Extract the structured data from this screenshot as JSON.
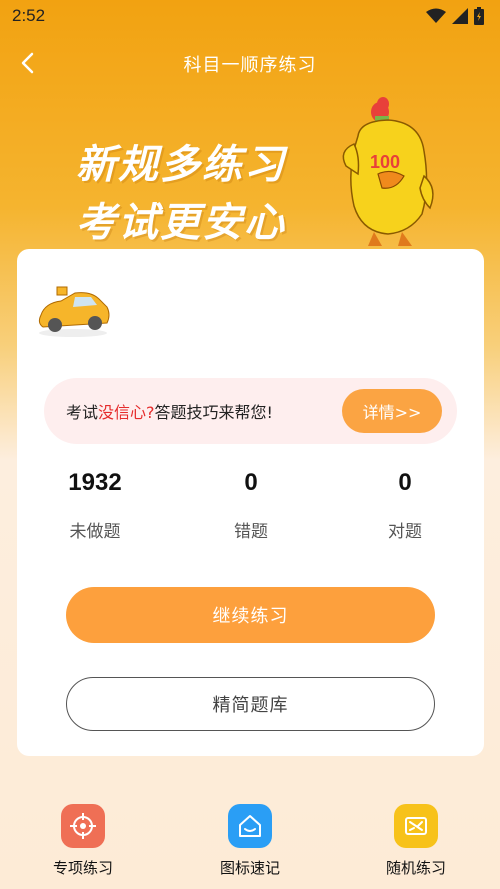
{
  "status_bar": {
    "time": "2:52"
  },
  "nav": {
    "title": "科目一顺序练习"
  },
  "hero": {
    "line1": "新规多练习",
    "line2": "考试更安心"
  },
  "mascot": {
    "badge": "100"
  },
  "tip": {
    "prefix": "考试",
    "highlight": "没信心?",
    "suffix": "答题技巧来帮您!",
    "button": "详情>>"
  },
  "stats": [
    {
      "value": "1932",
      "label": "未做题"
    },
    {
      "value": "0",
      "label": "错题"
    },
    {
      "value": "0",
      "label": "对题"
    }
  ],
  "buttons": {
    "continue": "继续练习",
    "question_bank": "精简题库"
  },
  "bottom_nav": [
    {
      "label": "专项练习",
      "icon": "target-icon",
      "color": "#ef6f55"
    },
    {
      "label": "图标速记",
      "icon": "home-smile-icon",
      "color": "#2a9ef5"
    },
    {
      "label": "随机练习",
      "icon": "shuffle-icon",
      "color": "#f7c21a"
    }
  ],
  "colors": {
    "accent": "#fda03d",
    "header": "#f2a211",
    "highlight_red": "#e52b2b"
  }
}
